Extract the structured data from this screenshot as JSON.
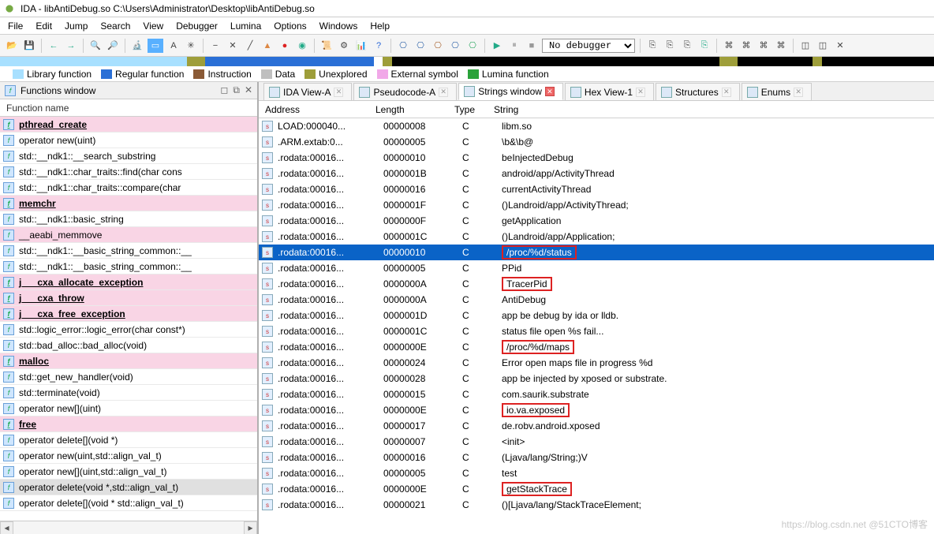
{
  "title": "IDA - libAntiDebug.so C:\\Users\\Administrator\\Desktop\\libAntiDebug.so",
  "menus": [
    "File",
    "Edit",
    "Jump",
    "Search",
    "View",
    "Debugger",
    "Lumina",
    "Options",
    "Windows",
    "Help"
  ],
  "debugger_label": "No debugger",
  "legend": [
    {
      "color": "#a8e0ff",
      "label": "Library function"
    },
    {
      "color": "#2a6fd6",
      "label": "Regular function"
    },
    {
      "color": "#8a5a36",
      "label": "Instruction"
    },
    {
      "color": "#bfbfbf",
      "label": "Data"
    },
    {
      "color": "#9e9e3a",
      "label": "Unexplored"
    },
    {
      "color": "#f1a8e8",
      "label": "External symbol"
    },
    {
      "color": "#2aa23a",
      "label": "Lumina function"
    }
  ],
  "left": {
    "title": "Functions window",
    "header": "Function name",
    "rows": [
      {
        "t": "pthread_create",
        "pink": true,
        "bold": true
      },
      {
        "t": "operator new(uint)"
      },
      {
        "t": "std::__ndk1::__search_substring<char,std::__n"
      },
      {
        "t": "std::__ndk1::char_traits<char>::find(char cons"
      },
      {
        "t": "std::__ndk1::char_traits<char>::compare(char"
      },
      {
        "t": "memchr",
        "pink": true,
        "bold": true
      },
      {
        "t": "std::__ndk1::basic_string<char,std::__ndk1::ch"
      },
      {
        "t": "__aeabi_memmove",
        "pink": true
      },
      {
        "t": "std::__ndk1::__basic_string_common<true>::__"
      },
      {
        "t": "std::__ndk1::__basic_string_common<true>::__"
      },
      {
        "t": "j___cxa_allocate_exception",
        "pink": true,
        "bold": true
      },
      {
        "t": "j___cxa_throw",
        "pink": true,
        "bold": true
      },
      {
        "t": "j___cxa_free_exception",
        "pink": true,
        "bold": true
      },
      {
        "t": "std::logic_error::logic_error(char const*)"
      },
      {
        "t": "std::bad_alloc::bad_alloc(void)"
      },
      {
        "t": "malloc",
        "pink": true,
        "bold": true
      },
      {
        "t": "std::get_new_handler(void)"
      },
      {
        "t": "std::terminate(void)"
      },
      {
        "t": "operator new[](uint)"
      },
      {
        "t": "free",
        "pink": true,
        "bold": true
      },
      {
        "t": "operator delete[](void *)"
      },
      {
        "t": "operator new(uint,std::align_val_t)"
      },
      {
        "t": "operator new[](uint,std::align_val_t)"
      },
      {
        "t": "operator delete(void *,std::align_val_t)",
        "sel": true
      },
      {
        "t": "operator delete[](void * std::align_val_t)"
      }
    ]
  },
  "tabs": [
    {
      "l": "IDA View-A"
    },
    {
      "l": "Pseudocode-A"
    },
    {
      "l": "Strings window",
      "active": true,
      "red": true
    },
    {
      "l": "Hex View-1"
    },
    {
      "l": "Structures"
    },
    {
      "l": "Enums"
    }
  ],
  "cols": {
    "c1": "Address",
    "c2": "Length",
    "c3": "Type",
    "c4": "String"
  },
  "strings": [
    {
      "a": "LOAD:000040...",
      "l": "00000008",
      "t": "C",
      "s": "libm.so"
    },
    {
      "a": ".ARM.extab:0...",
      "l": "00000005",
      "t": "C",
      "s": "\\b&\\b@"
    },
    {
      "a": ".rodata:00016...",
      "l": "00000010",
      "t": "C",
      "s": "beInjectedDebug"
    },
    {
      "a": ".rodata:00016...",
      "l": "0000001B",
      "t": "C",
      "s": "android/app/ActivityThread"
    },
    {
      "a": ".rodata:00016...",
      "l": "00000016",
      "t": "C",
      "s": "currentActivityThread"
    },
    {
      "a": ".rodata:00016...",
      "l": "0000001F",
      "t": "C",
      "s": "()Landroid/app/ActivityThread;"
    },
    {
      "a": ".rodata:00016...",
      "l": "0000000F",
      "t": "C",
      "s": "getApplication"
    },
    {
      "a": ".rodata:00016...",
      "l": "0000001C",
      "t": "C",
      "s": "()Landroid/app/Application;"
    },
    {
      "a": ".rodata:00016...",
      "l": "00000010",
      "t": "C",
      "s": "/proc/%d/status",
      "sel": true,
      "box": true
    },
    {
      "a": ".rodata:00016...",
      "l": "00000005",
      "t": "C",
      "s": "PPid"
    },
    {
      "a": ".rodata:00016...",
      "l": "0000000A",
      "t": "C",
      "s": "TracerPid",
      "box": true
    },
    {
      "a": ".rodata:00016...",
      "l": "0000000A",
      "t": "C",
      "s": "AntiDebug"
    },
    {
      "a": ".rodata:00016...",
      "l": "0000001D",
      "t": "C",
      "s": "app be debug by ida or lldb."
    },
    {
      "a": ".rodata:00016...",
      "l": "0000001C",
      "t": "C",
      "s": "status file open %s fail..."
    },
    {
      "a": ".rodata:00016...",
      "l": "0000000E",
      "t": "C",
      "s": "/proc/%d/maps",
      "box": true
    },
    {
      "a": ".rodata:00016...",
      "l": "00000024",
      "t": "C",
      "s": "Error open maps file in progress %d"
    },
    {
      "a": ".rodata:00016...",
      "l": "00000028",
      "t": "C",
      "s": "app be injected by xposed or substrate."
    },
    {
      "a": ".rodata:00016...",
      "l": "00000015",
      "t": "C",
      "s": "com.saurik.substrate"
    },
    {
      "a": ".rodata:00016...",
      "l": "0000000E",
      "t": "C",
      "s": "io.va.exposed",
      "box": true
    },
    {
      "a": ".rodata:00016...",
      "l": "00000017",
      "t": "C",
      "s": "de.robv.android.xposed"
    },
    {
      "a": ".rodata:00016...",
      "l": "00000007",
      "t": "C",
      "s": "<init>"
    },
    {
      "a": ".rodata:00016...",
      "l": "00000016",
      "t": "C",
      "s": "(Ljava/lang/String;)V"
    },
    {
      "a": ".rodata:00016...",
      "l": "00000005",
      "t": "C",
      "s": "test"
    },
    {
      "a": ".rodata:00016...",
      "l": "0000000E",
      "t": "C",
      "s": "getStackTrace",
      "box": true
    },
    {
      "a": ".rodata:00016...",
      "l": "00000021",
      "t": "C",
      "s": "()[Ljava/lang/StackTraceElement;"
    }
  ],
  "watermark": "https://blog.csdn.net @51CTO博客"
}
